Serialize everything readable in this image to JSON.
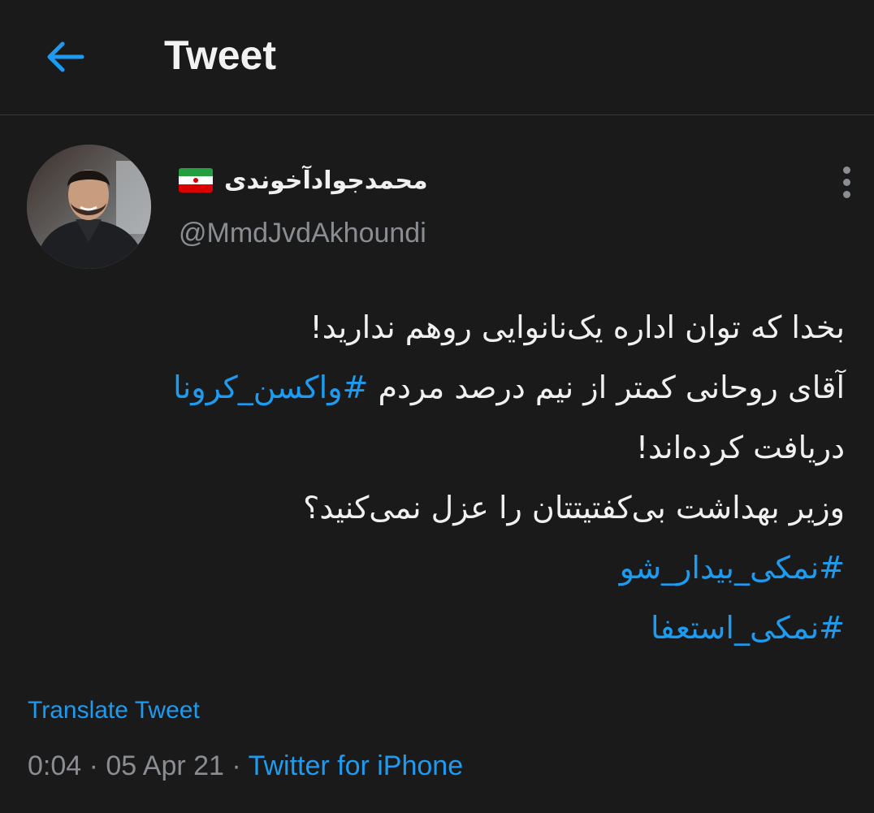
{
  "header": {
    "title": "Tweet",
    "back_icon": "arrow-left-icon",
    "accent_color": "#1d9bf0"
  },
  "author": {
    "display_name": "محمدجوادآخوندی",
    "flag_icon": "iran-flag-icon",
    "handle": "@MmdJvdAkhoundi"
  },
  "tweet": {
    "line1": "بخدا که توان اداره یک‌نانوایی روهم ندارید!",
    "line2_text": "آقای روحانی کمتر از نیم درصد مردم ",
    "line2_hashtag": "#واکسن_کرونا",
    "line3": "دریافت کرده‌اند!",
    "line4": "وزیر بهداشت بی‌کفتیتتان را عزل نمی‌کنید؟",
    "hashtag1": "#نمکی_بیدار_شو",
    "hashtag2": "#نمکی_استعفا"
  },
  "footer": {
    "translate_label": "Translate Tweet",
    "timestamp": "0:04 · 05 Apr 21 · ",
    "source": "Twitter for iPhone"
  }
}
